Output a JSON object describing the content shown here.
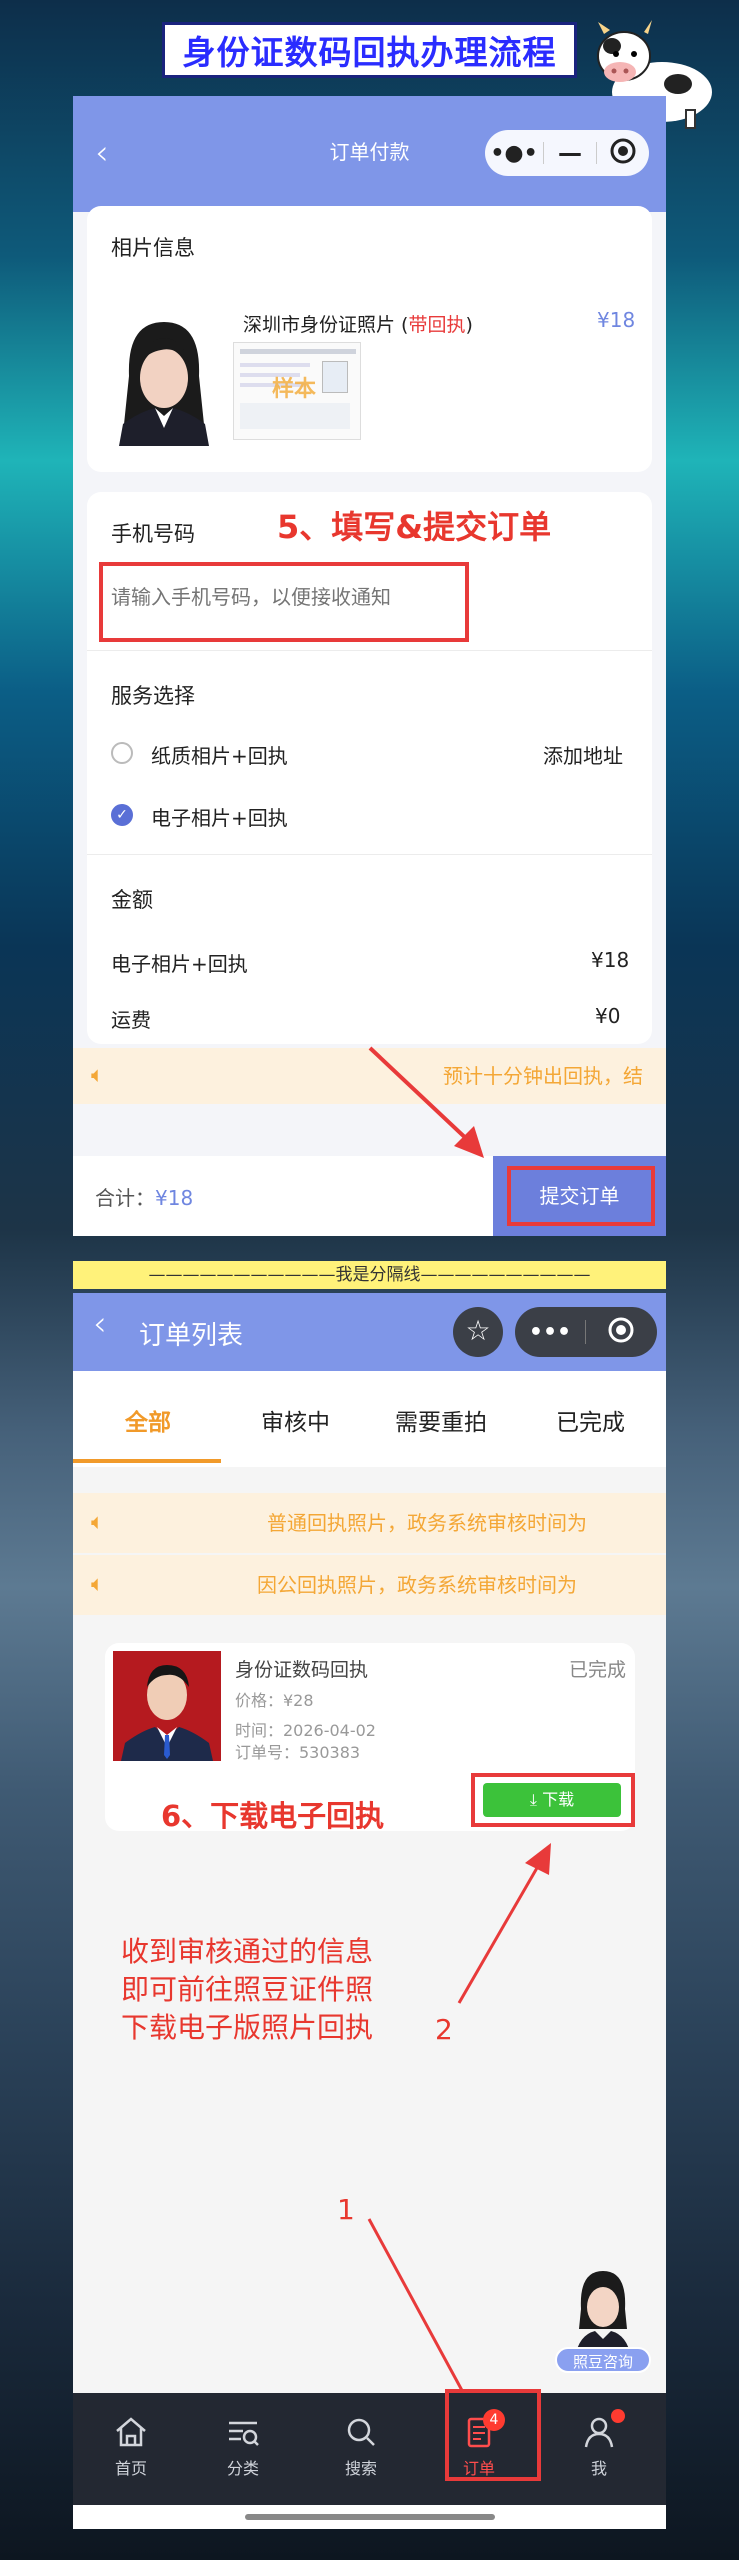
{
  "banner": {
    "title": "身份证数码回执办理流程"
  },
  "order_pay": {
    "nav_title": "订单付款",
    "photo_section_title": "相片信息",
    "product_name_prefix": "深圳市身份证照片 (",
    "product_name_tag": "带回执",
    "product_name_suffix": ")",
    "product_price": "¥18",
    "sample_label": "样本",
    "step_label": "5、填写&提交订单",
    "phone_label": "手机号码",
    "phone_placeholder": "请输入手机号码，以便接收通知",
    "service_label": "服务选择",
    "options": [
      {
        "label": "纸质相片+回执",
        "selected": false,
        "extra": "添加地址"
      },
      {
        "label": "电子相片+回执",
        "selected": true,
        "extra": ""
      }
    ],
    "amount_label": "金额",
    "amount_rows": [
      {
        "label": "电子相片+回执",
        "value": "¥18"
      },
      {
        "label": "运费",
        "value": "¥0"
      }
    ],
    "notice": "预计十分钟出回执，结",
    "total_label": "合计：",
    "total_value": "¥18",
    "submit_label": "提交订单"
  },
  "separator": "———————————我是分隔线——————————",
  "order_list": {
    "nav_title": "订单列表",
    "tabs": [
      {
        "label": "全部",
        "active": true
      },
      {
        "label": "审核中",
        "active": false
      },
      {
        "label": "需要重拍",
        "active": false
      },
      {
        "label": "已完成",
        "active": false
      }
    ],
    "notices": [
      "普通回执照片，政务系统审核时间为",
      "因公回执照片，政务系统审核时间为"
    ],
    "order": {
      "title": "身份证数码回执",
      "status": "已完成",
      "price": "价格：¥28",
      "time": "时间：2026-04-02",
      "order_no": "订单号：530383",
      "download_label": "下载"
    },
    "step_label": "6、下载电子回执",
    "annotation_lines": [
      "收到审核通过的信息",
      "即可前往照豆证件照",
      "下载电子版照片回执"
    ],
    "arrow_labels": [
      "2",
      "1"
    ],
    "assistant_label": "照豆咨询",
    "tabbar": [
      {
        "label": "首页",
        "icon": "home-icon"
      },
      {
        "label": "分类",
        "icon": "category-icon"
      },
      {
        "label": "搜索",
        "icon": "search-icon"
      },
      {
        "label": "订单",
        "icon": "order-icon",
        "badge": "4",
        "active": true
      },
      {
        "label": "我",
        "icon": "user-icon"
      }
    ]
  },
  "colors": {
    "accent": "#7f96e8",
    "red": "#e8372e",
    "orange": "#f4a736",
    "green": "#3cc23a"
  }
}
